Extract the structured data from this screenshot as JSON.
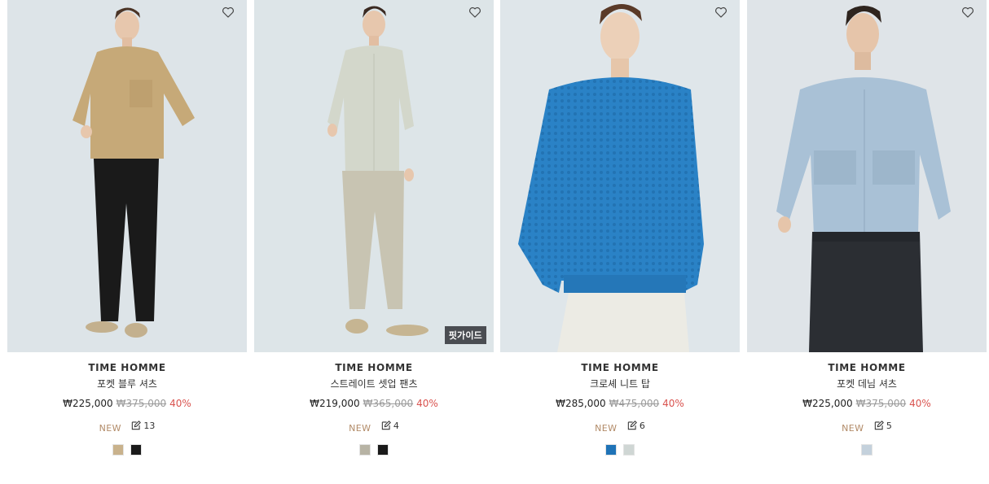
{
  "products": [
    {
      "brand": "TIME HOMME",
      "name": "포켓 블루 셔츠",
      "price": "₩225,000",
      "original_price": "₩375,000",
      "discount": "40%",
      "badge": "NEW",
      "review_count": "13",
      "fit_guide": "",
      "swatches": [
        "#c9b28c",
        "#1a1a1a"
      ],
      "icon": "heart-icon"
    },
    {
      "brand": "TIME HOMME",
      "name": "스트레이트 셋업 팬츠",
      "price": "₩219,000",
      "original_price": "₩365,000",
      "discount": "40%",
      "badge": "NEW",
      "review_count": "4",
      "fit_guide": "핏가이드",
      "swatches": [
        "#b7b3a4",
        "#1a1a1a"
      ],
      "icon": "heart-icon"
    },
    {
      "brand": "TIME HOMME",
      "name": "크로셰 니트 탑",
      "price": "₩285,000",
      "original_price": "₩475,000",
      "discount": "40%",
      "badge": "NEW",
      "review_count": "6",
      "fit_guide": "",
      "swatches": [
        "#1f73b7",
        "#cfd6d4"
      ],
      "icon": "heart-icon"
    },
    {
      "brand": "TIME HOMME",
      "name": "포켓 데님 셔츠",
      "price": "₩225,000",
      "original_price": "₩375,000",
      "discount": "40%",
      "badge": "NEW",
      "review_count": "5",
      "fit_guide": "",
      "swatches": [
        "#c4d1dc"
      ],
      "icon": "heart-icon"
    }
  ],
  "colors": {
    "discount": "#d9534f",
    "new_badge": "#b28b68",
    "strike": "#9a9a9a"
  }
}
